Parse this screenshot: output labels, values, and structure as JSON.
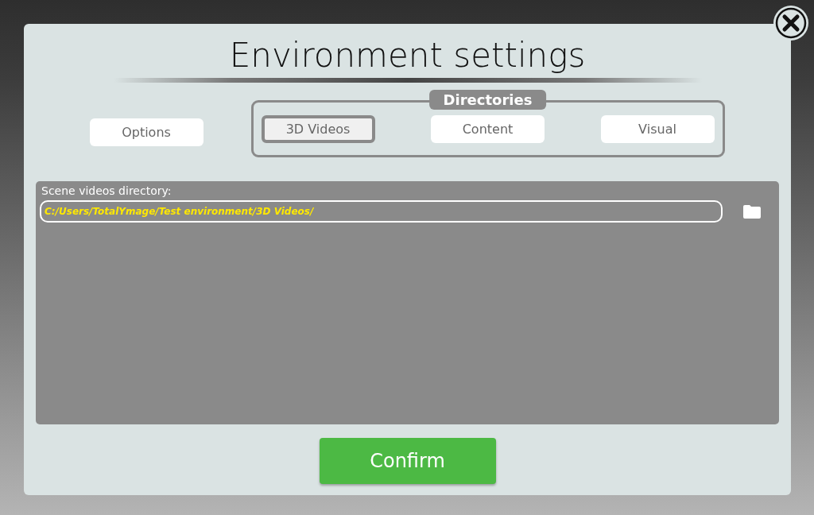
{
  "title": "Environment settings",
  "tabs": [
    {
      "label": "Options",
      "selected": false
    }
  ],
  "tab_group": {
    "label": "Directories",
    "tabs": [
      {
        "label": "3D Videos",
        "selected": true
      },
      {
        "label": "Content",
        "selected": false
      },
      {
        "label": "Visual",
        "selected": false
      }
    ]
  },
  "panel": {
    "label": "Scene videos directory:",
    "field": {
      "value": "C:/Users/TotalYmage/Test environment/3D Videos/"
    }
  },
  "confirm_button": "Confirm"
}
